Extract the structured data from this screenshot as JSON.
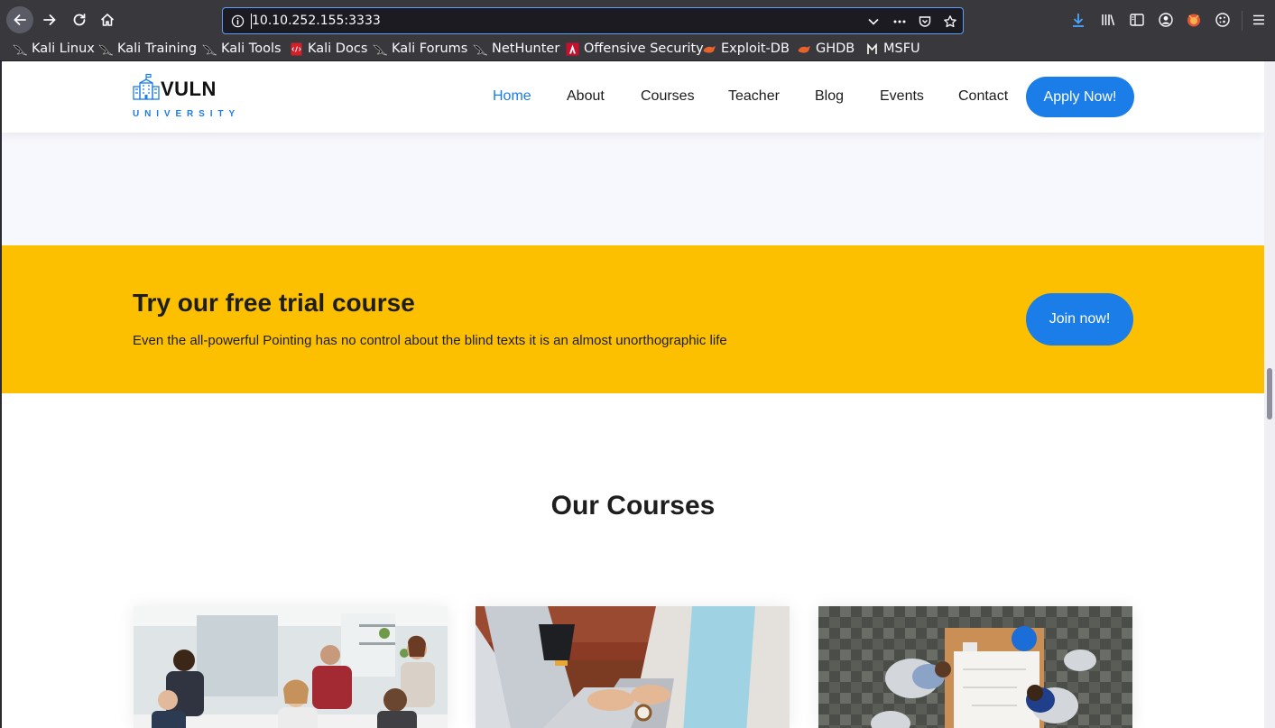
{
  "browser": {
    "url": "10.10.252.155:3333",
    "bookmarks": [
      {
        "label": "Kali Linux",
        "icon": "kali-dragon-icon"
      },
      {
        "label": "Kali Training",
        "icon": "kali-dragon-icon"
      },
      {
        "label": "Kali Tools",
        "icon": "kali-dragon-icon"
      },
      {
        "label": "Kali Docs",
        "icon": "kali-docs-icon"
      },
      {
        "label": "Kali Forums",
        "icon": "kali-dragon-icon"
      },
      {
        "label": "NetHunter",
        "icon": "kali-dragon-icon"
      },
      {
        "label": "Offensive Security",
        "icon": "offsec-icon"
      },
      {
        "label": "Exploit-DB",
        "icon": "exploitdb-icon"
      },
      {
        "label": "GHDB",
        "icon": "exploitdb-icon"
      },
      {
        "label": "MSFU",
        "icon": "msfu-icon"
      }
    ],
    "accent": "#5a9ff5"
  },
  "site": {
    "logo": {
      "name": "VULN",
      "sub": "UNIVERSITY",
      "icon": "university-building-icon"
    },
    "nav": [
      {
        "label": "Home",
        "active": true
      },
      {
        "label": "About",
        "active": false
      },
      {
        "label": "Courses",
        "active": false
      },
      {
        "label": "Teacher",
        "active": false
      },
      {
        "label": "Blog",
        "active": false
      },
      {
        "label": "Events",
        "active": false
      },
      {
        "label": "Contact",
        "active": false
      }
    ],
    "apply_label": "Apply Now!",
    "trial": {
      "title": "Try our free trial course",
      "text": "Even the all-powerful Pointing has no control about the blind texts it is an almost unorthographic life",
      "button": "Join now!"
    },
    "courses_title": "Our Courses",
    "colors": {
      "primary": "#1a7de8",
      "band": "#fcc000"
    }
  }
}
